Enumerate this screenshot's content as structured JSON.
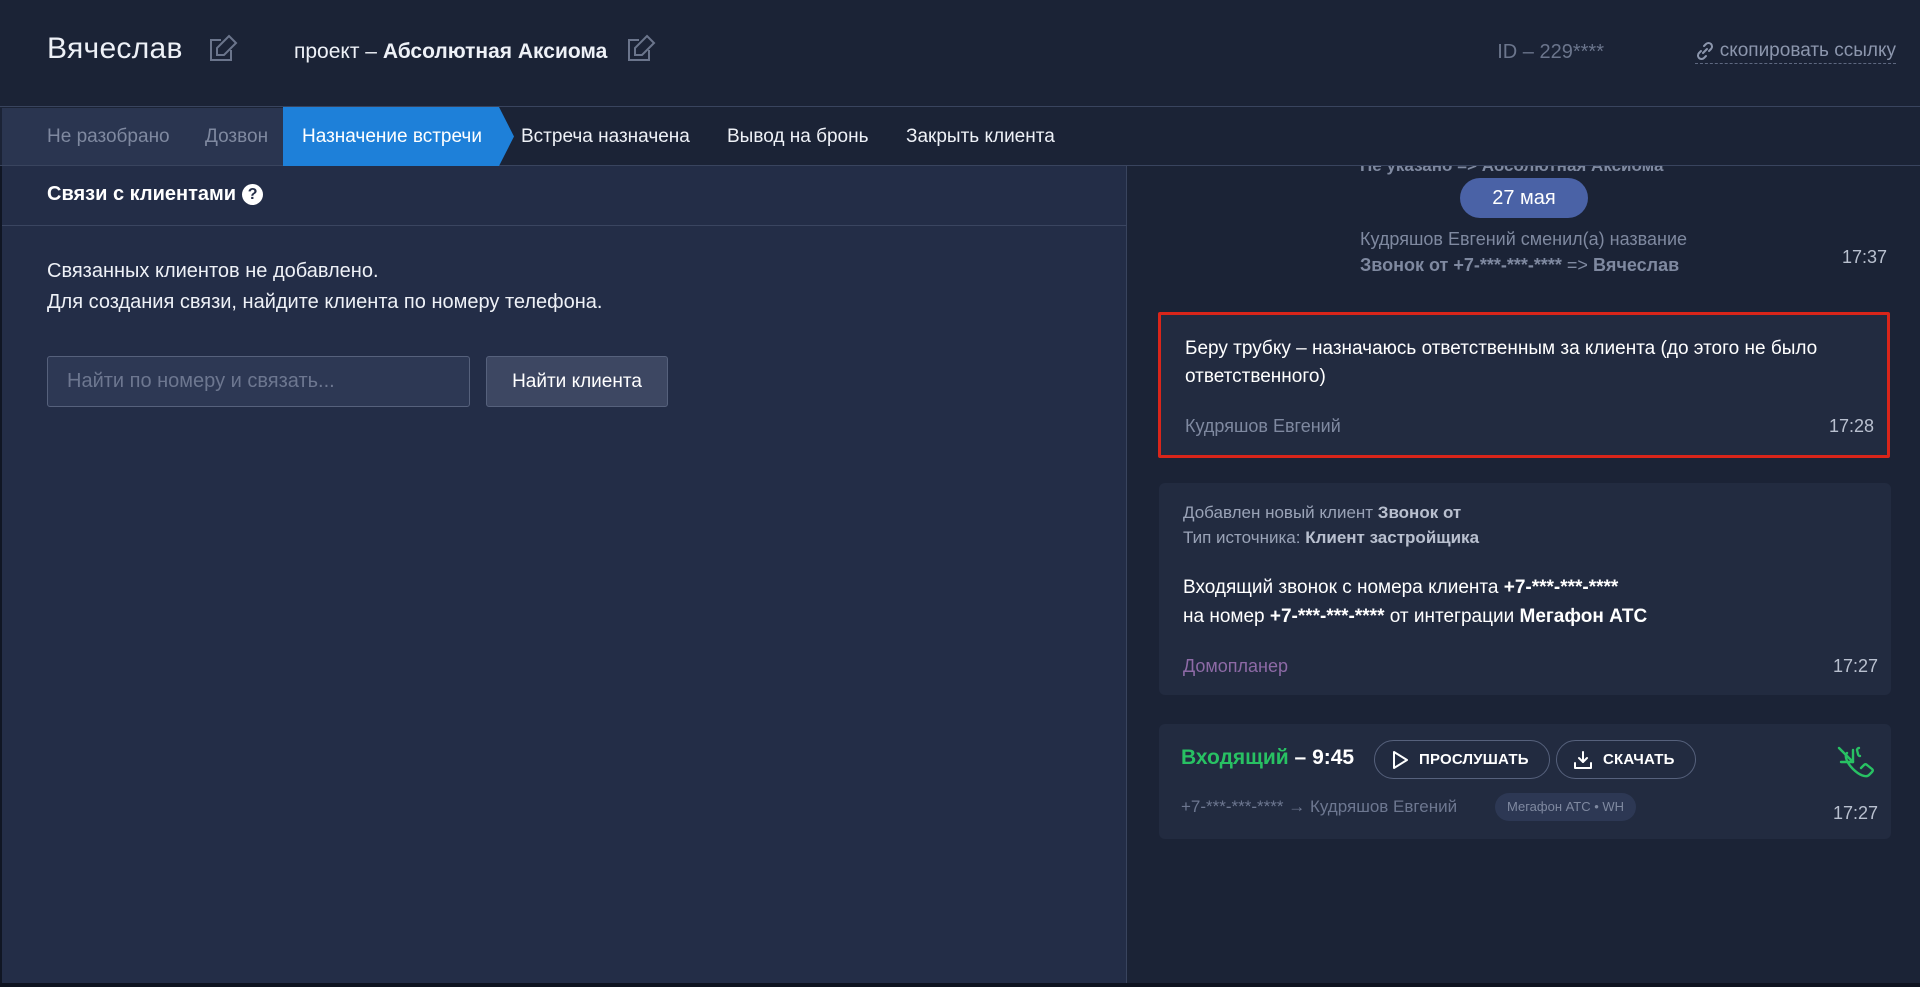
{
  "header": {
    "client_name": "Вячеслав",
    "project_prefix": "проект –",
    "project_name": "Абсолютная Аксиома",
    "deal_id": "ID – 229****",
    "copy_link_label": "скопировать ссылку"
  },
  "stages": [
    {
      "label": "Не разобрано",
      "state": "done"
    },
    {
      "label": "Дозвон",
      "state": "done"
    },
    {
      "label": "Назначение встречи",
      "state": "active"
    },
    {
      "label": "Встреча назначена",
      "state": "todo"
    },
    {
      "label": "Вывод на бронь",
      "state": "todo"
    },
    {
      "label": "Закрыть клиента",
      "state": "todo"
    }
  ],
  "links": {
    "title": "Связи с клиентами",
    "help": "?",
    "empty_line1": "Связанных клиентов не добавлено.",
    "empty_line2": "Для создания связи, найдите клиента по номеру телефона.",
    "search_placeholder": "Найти по номеру и связать...",
    "find_button": "Найти клиента"
  },
  "feed": {
    "clipped_text": "Не указано => Абсолютная Аксиома",
    "date_badge": "27 мая",
    "rename": {
      "line1": "Кудряшов Евгений сменил(а) название",
      "old_name": "Звонок от +7-***-***-****",
      "arrow": " => ",
      "new_name": "Вячеслав",
      "time": "17:37"
    },
    "comment": {
      "text": "Беру трубку – назначаюсь ответственным за клиента (до этого не было ответственного)",
      "author": "Кудряшов Евгений",
      "time": "17:28"
    },
    "new_client": {
      "added_label": "Добавлен новый клиент ",
      "added_value": "Звонок от",
      "source_label": "Тип источника: ",
      "source_value": "Клиент застройщика",
      "call_prefix": "Входящий звонок с номера клиента ",
      "client_phone": "+7-***-***-****",
      "to_prefix": "на номер ",
      "to_phone": "+7-***-***-****",
      "integration_prefix": " от интеграции ",
      "integration": "Мегафон АТС",
      "author": "Домопланер",
      "time": "17:27"
    },
    "call": {
      "direction": "Входящий",
      "duration": " – 9:45",
      "listen_button": "ПРОСЛУШАТЬ",
      "download_button": "СКАЧАТЬ",
      "route": "+7-***-***-**** → Кудряшов Евгений",
      "tag": "Мегафон АТС • WH",
      "time": "17:27"
    }
  },
  "colors": {
    "background": "#1b2336",
    "panel": "#232d47",
    "accent": "#1e80d9",
    "incoming": "#28c163",
    "highlight": "#d9251a",
    "date_badge": "#4a62a6"
  }
}
